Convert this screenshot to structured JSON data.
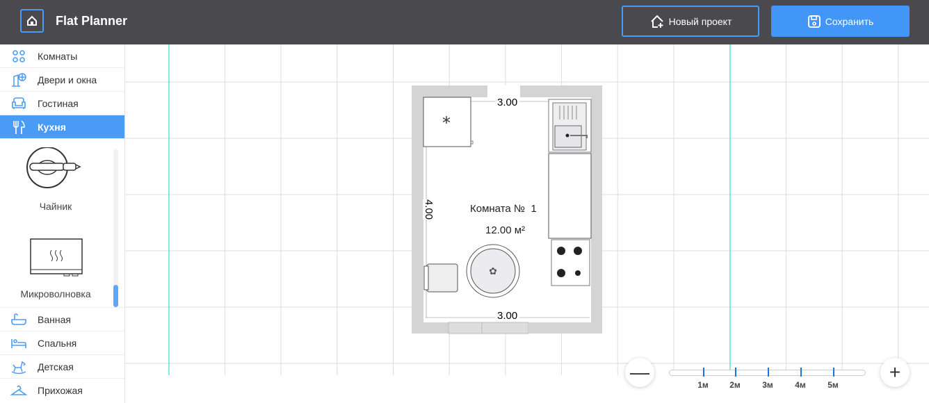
{
  "header": {
    "title": "Flat Planner",
    "new_project": "Новый проект",
    "save": "Сохранить"
  },
  "sidebar": {
    "items": [
      {
        "label": "Комнаты",
        "icon": "rooms-icon"
      },
      {
        "label": "Двери и окна",
        "icon": "doors-windows-icon"
      },
      {
        "label": "Гостиная",
        "icon": "sofa-icon"
      },
      {
        "label": "Кухня",
        "icon": "fork-knife-icon",
        "active": true
      },
      {
        "label": "Ванная",
        "icon": "bathtub-icon"
      },
      {
        "label": "Спальня",
        "icon": "bed-icon"
      },
      {
        "label": "Детская",
        "icon": "rocking-horse-icon"
      },
      {
        "label": "Прихожая",
        "icon": "hanger-icon"
      }
    ],
    "kitchen_items": [
      {
        "label": "Чайник"
      },
      {
        "label": "Микроволновка"
      }
    ]
  },
  "plan": {
    "room_name": "Комната №  1",
    "area": "12.00 м²",
    "width_top": "3.00",
    "width_bottom": "3.00",
    "height": "4.00"
  },
  "scale": {
    "labels": [
      "1м",
      "2м",
      "3м",
      "4м",
      "5м"
    ]
  },
  "colors": {
    "accent": "#4a9bf5",
    "header": "#4a494e",
    "guide": "#40e0e0"
  }
}
